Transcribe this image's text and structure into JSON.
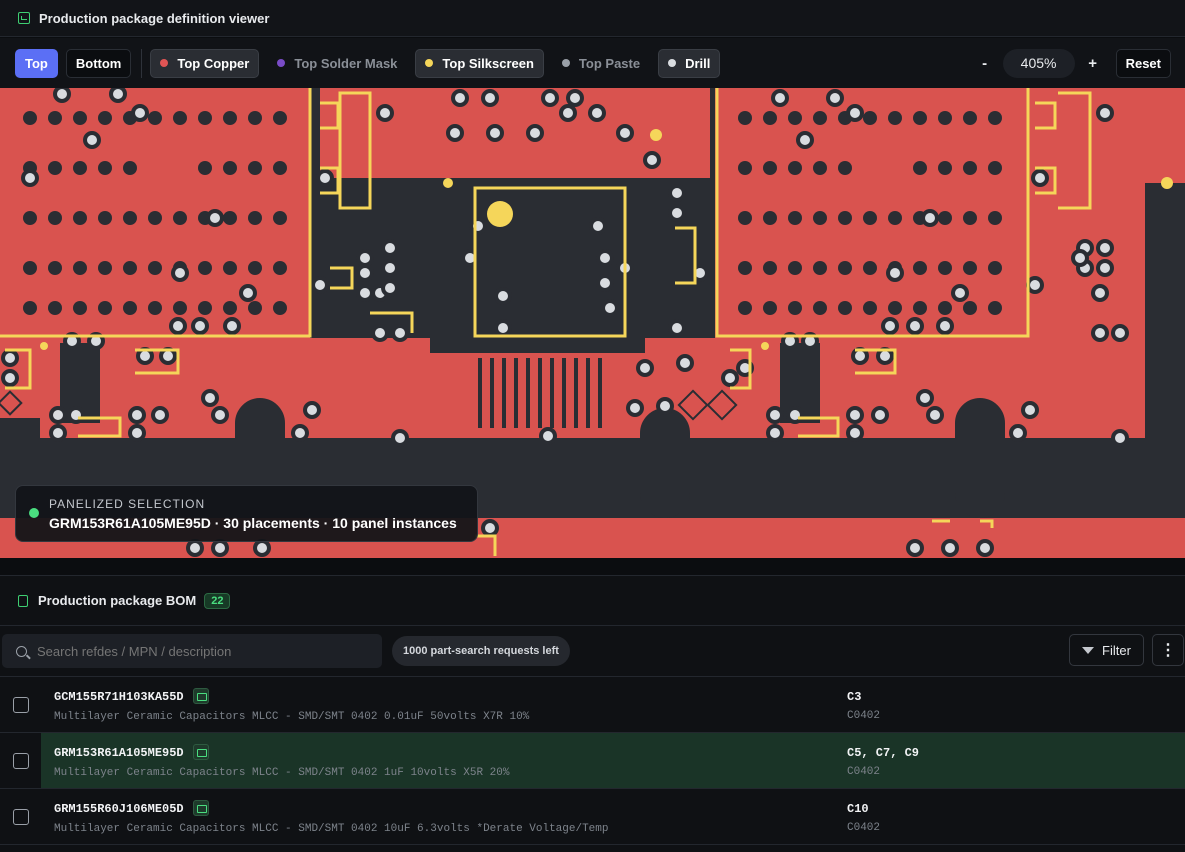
{
  "viewer": {
    "title": "Production package definition viewer"
  },
  "toolbar": {
    "side_buttons": [
      {
        "label": "Top",
        "active": true
      },
      {
        "label": "Bottom",
        "active": false
      }
    ],
    "layers": [
      {
        "label": "Top Copper",
        "color": "#e05555",
        "enabled": true
      },
      {
        "label": "Top Solder Mask",
        "color": "#7a4cc7",
        "enabled": false
      },
      {
        "label": "Top Silkscreen",
        "color": "#f5d65a",
        "enabled": true
      },
      {
        "label": "Top Paste",
        "color": "#9aa0a8",
        "enabled": false
      },
      {
        "label": "Drill",
        "color": "#d9dce0",
        "enabled": true
      }
    ],
    "zoom_out": "-",
    "zoom": "405%",
    "zoom_in": "+",
    "reset": "Reset"
  },
  "board": {
    "copper": "#d9534f",
    "silk": "#f5d65a",
    "substrate": "#2a2d33"
  },
  "selection": {
    "heading": "PANELIZED SELECTION",
    "summary": "GRM153R61A105ME95D · 30 placements · 10 panel instances"
  },
  "bom": {
    "title": "Production package BOM",
    "count": "22",
    "search_placeholder": "Search refdes / MPN / description",
    "quota": "1000 part-search requests left",
    "filter": "Filter",
    "more": "⋮",
    "rows": [
      {
        "mpn": "GCM155R71H103KA55D",
        "desc": "Multilayer Ceramic Capacitors MLCC - SMD/SMT 0402 0.01uF 50volts X7R 10%",
        "refs": "C3",
        "footprint": "C0402",
        "selected": false
      },
      {
        "mpn": "GRM153R61A105ME95D",
        "desc": "Multilayer Ceramic Capacitors MLCC - SMD/SMT 0402 1uF 10volts X5R 20%",
        "refs": "C5, C7, C9",
        "footprint": "C0402",
        "selected": true
      },
      {
        "mpn": "GRM155R60J106ME05D",
        "desc": "Multilayer Ceramic Capacitors MLCC - SMD/SMT 0402 10uF 6.3volts *Derate Voltage/Temp",
        "refs": "C10",
        "footprint": "C0402",
        "selected": false
      }
    ]
  }
}
